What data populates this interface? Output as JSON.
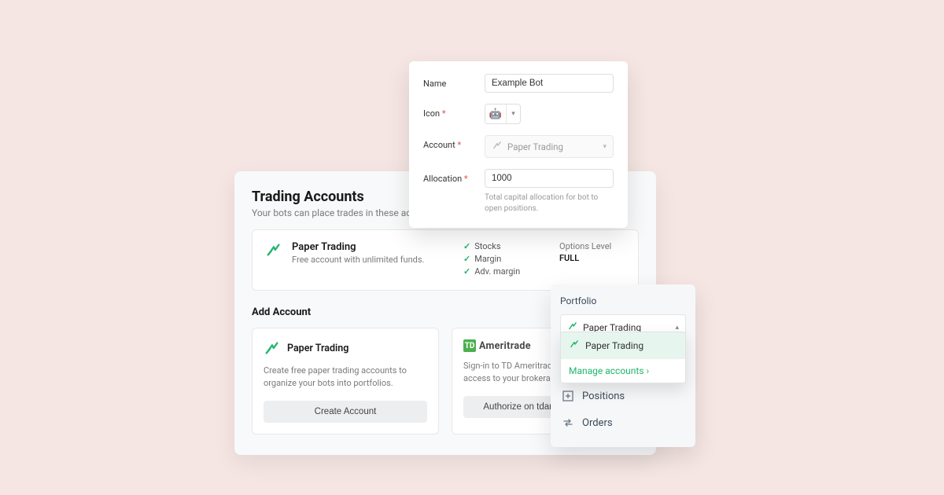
{
  "trading": {
    "title": "Trading Accounts",
    "subtitle": "Your bots can place trades in these accounts.",
    "account": {
      "name": "Paper Trading",
      "desc": "Free account with unlimited funds.",
      "features": [
        "Stocks",
        "Margin",
        "Adv. margin"
      ],
      "options_label": "Options Level",
      "options_value": "FULL"
    },
    "add_title": "Add Account",
    "providers": {
      "paper": {
        "title": "Paper Trading",
        "desc": "Create free paper trading accounts to organize your bots into portfolios.",
        "button": "Create Account"
      },
      "td": {
        "brand": "Ameritrade",
        "brand_prefix": "TD",
        "desc": "Sign-in to TD Ameritrade to authorize access to your brokerage account.",
        "button": "Authorize on tdameritrade.com"
      }
    }
  },
  "form": {
    "name_label": "Name",
    "name_value": "Example Bot",
    "icon_label": "Icon",
    "account_label": "Account",
    "account_value": "Paper Trading",
    "allocation_label": "Allocation",
    "allocation_value": "1000",
    "allocation_hint": "Total capital allocation for bot to open positions."
  },
  "portfolio": {
    "title": "Portfolio",
    "selected": "Paper Trading",
    "dropdown_option": "Paper Trading",
    "manage": "Manage accounts ›",
    "menu": {
      "positions": "Positions",
      "orders": "Orders"
    }
  }
}
